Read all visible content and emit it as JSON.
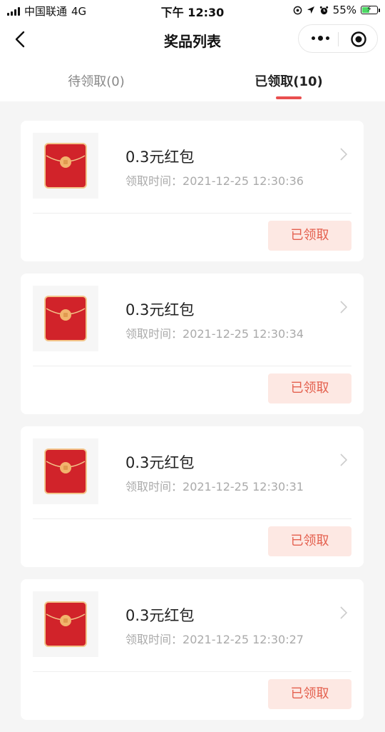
{
  "status_bar": {
    "carrier": "中国联通",
    "network": "4G",
    "time": "下午 12:30",
    "battery_percent": "55%",
    "battery_level": 0.55
  },
  "navbar": {
    "title": "奖品列表",
    "back_icon": "chevron-left-icon",
    "more_icon": "more-dots-icon",
    "close_icon": "target-icon"
  },
  "tabs": [
    {
      "label": "待领取(0)",
      "active": false
    },
    {
      "label": "已领取(10)",
      "active": true
    }
  ],
  "colors": {
    "accent": "#e94f4f",
    "envelope_red": "#d1232a",
    "button_bg": "#fde8e3",
    "button_text": "#e4604e"
  },
  "prizes": [
    {
      "name": "0.3元红包",
      "time_label": "领取时间：",
      "time": "2021-12-25 12:30:36",
      "status": "已领取"
    },
    {
      "name": "0.3元红包",
      "time_label": "领取时间：",
      "time": "2021-12-25 12:30:34",
      "status": "已领取"
    },
    {
      "name": "0.3元红包",
      "time_label": "领取时间：",
      "time": "2021-12-25 12:30:31",
      "status": "已领取"
    },
    {
      "name": "0.3元红包",
      "time_label": "领取时间：",
      "time": "2021-12-25 12:30:27",
      "status": "已领取"
    }
  ]
}
